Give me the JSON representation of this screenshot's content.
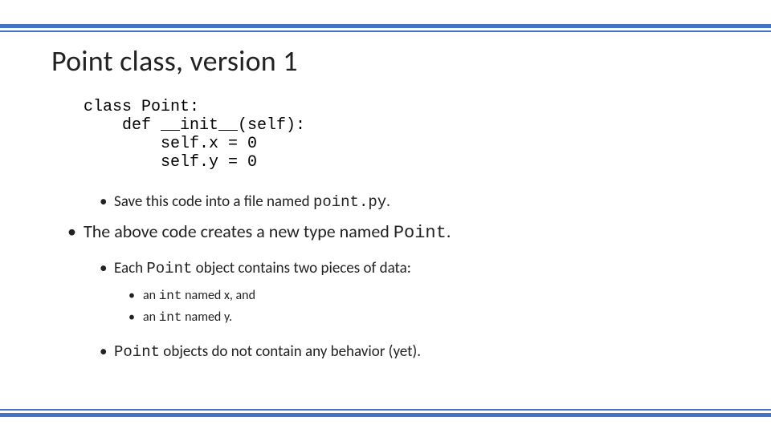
{
  "title": "Point class, version 1",
  "code": "class Point:\n    def __init__(self):\n        self.x = 0\n        self.y = 0",
  "bullets": {
    "save_file_pre": "Save this code into a file named ",
    "save_file_code": "point.py",
    "save_file_post": ".",
    "creates_type_pre": "The above code creates a new type named ",
    "creates_type_code": "Point",
    "creates_type_post": ".",
    "each_point_pre": "Each ",
    "each_point_code": "Point",
    "each_point_post": " object contains two pieces of data:",
    "int_x_pre": "an ",
    "int_x_code": "int",
    "int_x_post": " named x, and",
    "int_y_pre": "an ",
    "int_y_code": "int",
    "int_y_post": " named y.",
    "no_behavior_pre": "",
    "no_behavior_code": "Point",
    "no_behavior_post": " objects do not contain any behavior (yet)."
  }
}
